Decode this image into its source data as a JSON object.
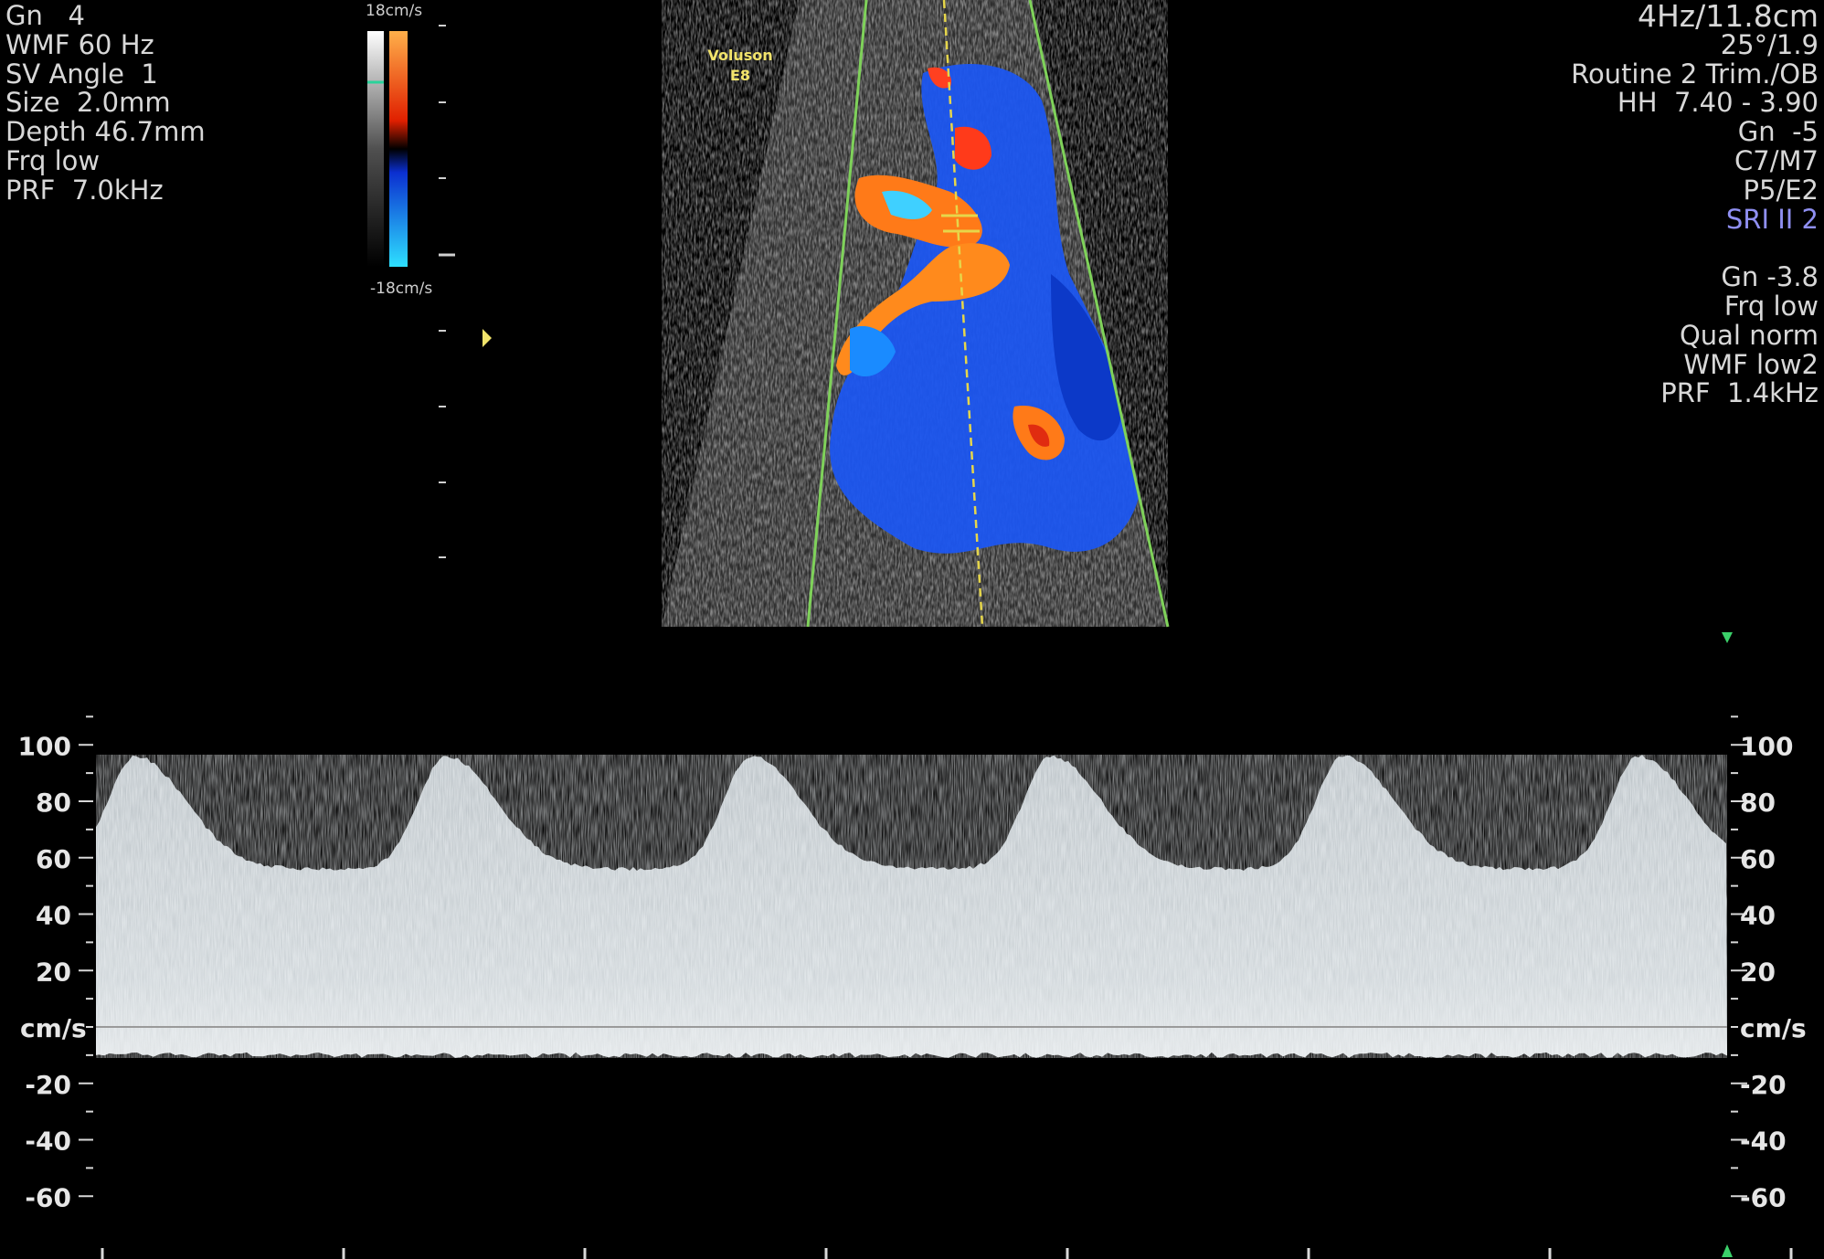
{
  "left_panel": {
    "lines": [
      "Gn   4",
      "WMF 60 Hz",
      "SV Angle  1",
      "Size  2.0mm",
      "Depth 46.7mm",
      "Frq low",
      "PRF  7.0kHz"
    ]
  },
  "right_panel": {
    "header": "4Hz/11.8cm",
    "lines": [
      "25°/1.9",
      "Routine 2 Trim./OB",
      "HH  7.40 - 3.90",
      "Gn  -5",
      "C7/M7",
      "P5/E2"
    ],
    "sri": "SRI II 2",
    "lines2": [
      "Gn -3.8",
      "Frq low",
      "Qual norm",
      "WMF low2",
      "PRF  1.4kHz"
    ]
  },
  "brand": {
    "name": "Voluson",
    "model": "E8"
  },
  "color_bar": {
    "top_label": "18cm/s",
    "bottom_label": "-18cm/s"
  },
  "velocity_scale": {
    "unit": "cm/s",
    "tick_labels": [
      "100",
      "80",
      "60",
      "40",
      "20",
      "-20",
      "-40",
      "-60"
    ]
  },
  "colors": {
    "background": "#000000",
    "text": "#d8d8d8",
    "sri_text": "#8f8ff2",
    "brand_text": "#f2e46b",
    "sector_line": "#7fd25a",
    "sample_line": "#e6d64a",
    "flow_forward": "#ff6a10",
    "flow_reverse": "#1a5cff",
    "spectrum": "#dfe6ea"
  }
}
